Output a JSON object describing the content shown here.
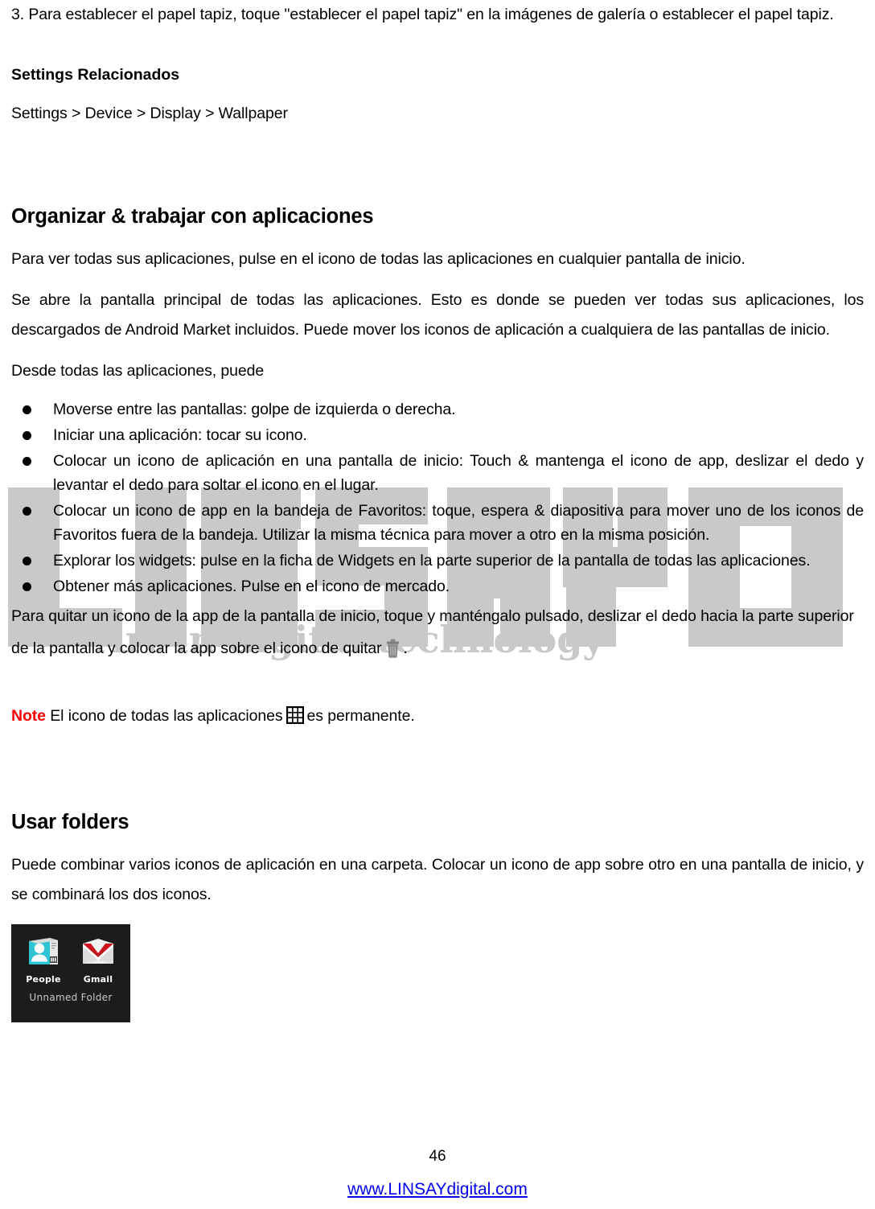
{
  "document": {
    "intro_step": "3. Para establecer el papel tapiz, toque \"establecer el papel tapiz\" en la imágenes de galería o establecer el papel tapiz.",
    "related_settings_heading": "Settings Relacionados",
    "related_settings_path": "Settings > Device > Display > Wallpaper",
    "section_apps": {
      "heading": "Organizar & trabajar con aplicaciones",
      "para1": "Para ver todas sus aplicaciones, pulse en el icono de todas las aplicaciones en cualquier pantalla de inicio.",
      "para2": "Se abre la pantalla principal de todas las aplicaciones. Esto es donde se pueden ver todas sus aplicaciones, los descargados de Android Market incluidos. Puede mover los iconos de aplicación a cualquiera de las pantallas de inicio.",
      "para3": "Desde todas las aplicaciones, puede",
      "bullets": [
        "Moverse entre las pantallas: golpe de izquierda o derecha.",
        "Iniciar una aplicación: tocar su icono.",
        "Colocar un icono de aplicación en una pantalla de inicio: Touch & mantenga el icono de app, deslizar el dedo y levantar el dedo para soltar el icono en el lugar.",
        "Colocar un icono de app en la bandeja de Favoritos: toque, espera & diapositiva para mover uno de los iconos de Favoritos fuera de la bandeja. Utilizar la misma técnica para mover a otro en la misma posición.",
        "Explorar los widgets: pulse en la ficha de Widgets en la parte superior de la pantalla de todas las aplicaciones.",
        "Obtener más aplicaciones. Pulse en el icono de mercado."
      ],
      "remove_para_part1": "Para quitar un icono de la app de la pantalla de inicio, toque y manténgalo pulsado, deslizar el dedo hacia la parte superior de la pantalla y colocar la app sobre el icono de quitar",
      "remove_para_part2": ".",
      "note_label": "Note",
      "note_text_before": "El icono de todas las aplicaciones",
      "note_text_after": "es permanente."
    },
    "section_folders": {
      "heading": "Usar folders",
      "para1": "Puede combinar varios iconos de aplicación en una carpeta. Colocar un icono de app sobre otro en una pantalla de inicio, y se combinará los dos iconos.",
      "screenshot": {
        "apps": [
          {
            "name": "People",
            "icon": "people-app-icon"
          },
          {
            "name": "Gmail",
            "icon": "gmail-app-icon"
          }
        ],
        "folder_name": "Unnamed Folder",
        "background_color": "#1c1c1c"
      }
    },
    "watermark": {
      "brand": "LINSAY",
      "tagline": "Art in digital technology",
      "color": "#c8c8c8"
    },
    "footer": {
      "page_number": "46",
      "website": "www.LINSAYdigital.com",
      "link_color": "#0000EE"
    },
    "icons": {
      "trash": "trash-icon",
      "all_apps": "all-apps-grid-icon"
    },
    "note_color": "#FF0000"
  }
}
